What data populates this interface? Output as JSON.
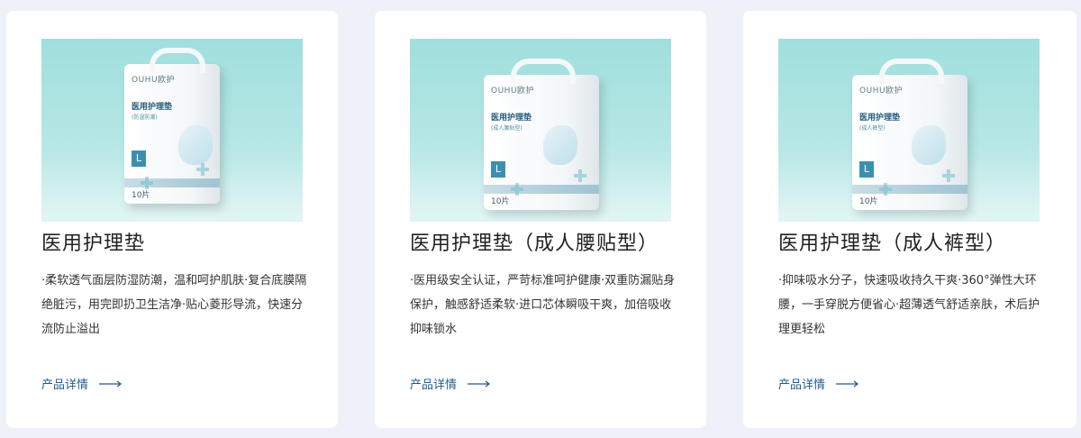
{
  "products": [
    {
      "title": "医用护理垫",
      "description": "·柔软透气面层防湿防潮，温和呵护肌肤·复合底膜隔绝脏污，用完即扔卫生洁净·贴心菱形导流，快速分流防止溢出",
      "more_label": "产品详情",
      "image": {
        "brand": "OUHU欧护",
        "pack_title": "医用护理垫",
        "pack_sub": "(防湿防潮)",
        "size": "L",
        "count": "10片"
      }
    },
    {
      "title": "医用护理垫（成人腰贴型）",
      "description": "·医用级安全认证，严苛标准呵护健康·双重防漏贴身保护，触感舒适柔软·进口芯体瞬吸干爽，加倍吸收抑味锁水",
      "more_label": "产品详情",
      "image": {
        "brand": "OUHU欧护",
        "pack_title": "医用护理垫",
        "pack_sub": "(成人腰贴型)",
        "size": "L",
        "count": "10片"
      }
    },
    {
      "title": "医用护理垫（成人裤型）",
      "description": "·抑味吸水分子，快速吸收持久干爽·360°弹性大环腰，一手穿脱方便省心·超薄透气舒适亲肤，术后护理更轻松",
      "more_label": "产品详情",
      "image": {
        "brand": "OUHU欧护",
        "pack_title": "医用护理垫",
        "pack_sub": "(成人裤型)",
        "size": "L",
        "count": "10片"
      }
    }
  ],
  "icons": {
    "more": "arrow-right-icon"
  },
  "colors": {
    "accent": "#1e5b93",
    "background": "#eef2f8",
    "card": "#ffffff",
    "image_bg": "#a9e2e0"
  }
}
